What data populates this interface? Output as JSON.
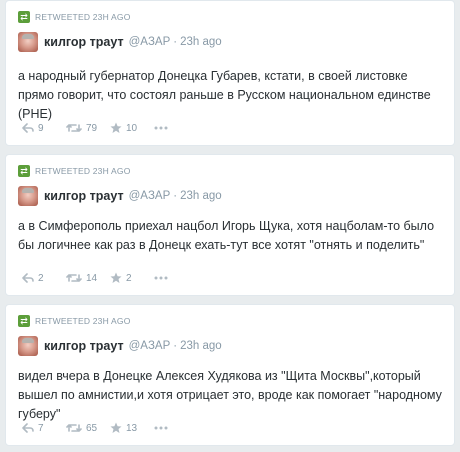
{
  "retweet_label": "RETWEETED 23H AGO",
  "colors": {
    "retweet_green": "#5c9e3a",
    "muted": "#8899a6",
    "text": "#292f33",
    "background": "#e8ecee"
  },
  "icons": [
    "retweet-badge-icon",
    "reply-icon",
    "retweet-icon",
    "favorite-star-icon",
    "more-dots-icon"
  ],
  "tweets": [
    {
      "author_name": "килгор траут",
      "handle": "@AЗAP",
      "separator": "·",
      "time": "23h ago",
      "text": "а народный губернатор Донецка Губарев, кстати, в своей листовке прямо говорит, что состоял раньше в Русском национальном единстве (РНЕ)",
      "replies": "9",
      "retweets": "79",
      "favorites": "10"
    },
    {
      "author_name": "килгор траут",
      "handle": "@AЗAP",
      "separator": "·",
      "time": "23h ago",
      "text": "а в Симферополь приехал нацбол Игорь Щука, хотя нацболам-то было бы логичнее как раз в Донецк ехать-тут все хотят \"отнять и поделить\"",
      "replies": "2",
      "retweets": "14",
      "favorites": "2"
    },
    {
      "author_name": "килгор траут",
      "handle": "@AЗAP",
      "separator": "·",
      "time": "23h ago",
      "text": "видел вчера в Донецке Алексея Худякова из \"Щита Москвы\",который вышел по амнистии,и хотя отрицает это, вроде как помогает \"народному губеру\"",
      "replies": "7",
      "retweets": "65",
      "favorites": "13"
    }
  ]
}
